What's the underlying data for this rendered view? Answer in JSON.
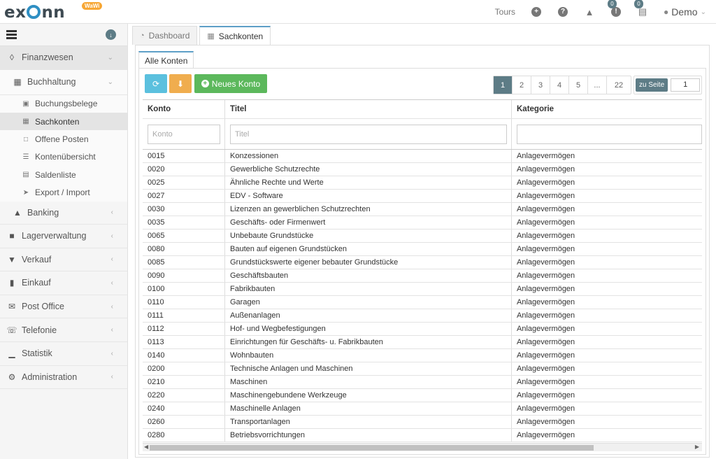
{
  "topbar": {
    "logo_text": "exonn",
    "logo_badge": "WaWi",
    "tours_label": "Tours",
    "notif_badge_1": "0",
    "notif_badge_2": "0",
    "user_name": "Demo"
  },
  "sidebar": {
    "items": [
      {
        "label": "Finanzwesen"
      },
      {
        "label": "Buchhaltung"
      },
      {
        "label": "Buchungsbelege"
      },
      {
        "label": "Sachkonten"
      },
      {
        "label": "Offene Posten"
      },
      {
        "label": "Kontenübersicht"
      },
      {
        "label": "Saldenliste"
      },
      {
        "label": "Export / Import"
      },
      {
        "label": "Banking"
      },
      {
        "label": "Lagerverwaltung"
      },
      {
        "label": "Verkauf"
      },
      {
        "label": "Einkauf"
      },
      {
        "label": "Post Office"
      },
      {
        "label": "Telefonie"
      },
      {
        "label": "Statistik"
      },
      {
        "label": "Administration"
      }
    ]
  },
  "tabs": {
    "dashboard": "Dashboard",
    "sachkonten": "Sachkonten",
    "alle_konten": "Alle Konten"
  },
  "toolbar": {
    "new_account_label": "Neues Konto"
  },
  "pager": {
    "pages": [
      "1",
      "2",
      "3",
      "4",
      "5",
      "...",
      "22"
    ],
    "goto_label": "zu Seite",
    "goto_value": "1"
  },
  "table": {
    "headers": {
      "konto": "Konto",
      "titel": "Titel",
      "kategorie": "Kategorie"
    },
    "filter_placeholders": {
      "konto": "Konto",
      "titel": "Titel"
    },
    "rows": [
      {
        "konto": "0015",
        "titel": "Konzessionen",
        "kategorie": "Anlagevermögen"
      },
      {
        "konto": "0020",
        "titel": "Gewerbliche Schutzrechte",
        "kategorie": "Anlagevermögen"
      },
      {
        "konto": "0025",
        "titel": "Ähnliche Rechte und Werte",
        "kategorie": "Anlagevermögen"
      },
      {
        "konto": "0027",
        "titel": "EDV - Software",
        "kategorie": "Anlagevermögen"
      },
      {
        "konto": "0030",
        "titel": "Lizenzen an gewerblichen Schutzrechten",
        "kategorie": "Anlagevermögen"
      },
      {
        "konto": "0035",
        "titel": "Geschäfts- oder Firmenwert",
        "kategorie": "Anlagevermögen"
      },
      {
        "konto": "0065",
        "titel": "Unbebaute Grundstücke",
        "kategorie": "Anlagevermögen"
      },
      {
        "konto": "0080",
        "titel": "Bauten auf eigenen Grundstücken",
        "kategorie": "Anlagevermögen"
      },
      {
        "konto": "0085",
        "titel": "Grundstückswerte eigener bebauter Grundstücke",
        "kategorie": "Anlagevermögen"
      },
      {
        "konto": "0090",
        "titel": "Geschäftsbauten",
        "kategorie": "Anlagevermögen"
      },
      {
        "konto": "0100",
        "titel": "Fabrikbauten",
        "kategorie": "Anlagevermögen"
      },
      {
        "konto": "0110",
        "titel": "Garagen",
        "kategorie": "Anlagevermögen"
      },
      {
        "konto": "0111",
        "titel": "Außenanlagen",
        "kategorie": "Anlagevermögen"
      },
      {
        "konto": "0112",
        "titel": "Hof- und Wegbefestigungen",
        "kategorie": "Anlagevermögen"
      },
      {
        "konto": "0113",
        "titel": "Einrichtungen für Geschäfts- u. Fabrikbauten",
        "kategorie": "Anlagevermögen"
      },
      {
        "konto": "0140",
        "titel": "Wohnbauten",
        "kategorie": "Anlagevermögen"
      },
      {
        "konto": "0200",
        "titel": "Technische Anlagen und Maschinen",
        "kategorie": "Anlagevermögen"
      },
      {
        "konto": "0210",
        "titel": "Maschinen",
        "kategorie": "Anlagevermögen"
      },
      {
        "konto": "0220",
        "titel": "Maschinengebundene Werkzeuge",
        "kategorie": "Anlagevermögen"
      },
      {
        "konto": "0240",
        "titel": "Maschinelle Anlagen",
        "kategorie": "Anlagevermögen"
      },
      {
        "konto": "0260",
        "titel": "Transportanlagen",
        "kategorie": "Anlagevermögen"
      },
      {
        "konto": "0280",
        "titel": "Betriebsvorrichtungen",
        "kategorie": "Anlagevermögen"
      }
    ]
  },
  "colors": {
    "accent": "#5d7c86",
    "refresh": "#5bc0de",
    "download": "#f0ad4e",
    "new": "#5cb85c"
  }
}
